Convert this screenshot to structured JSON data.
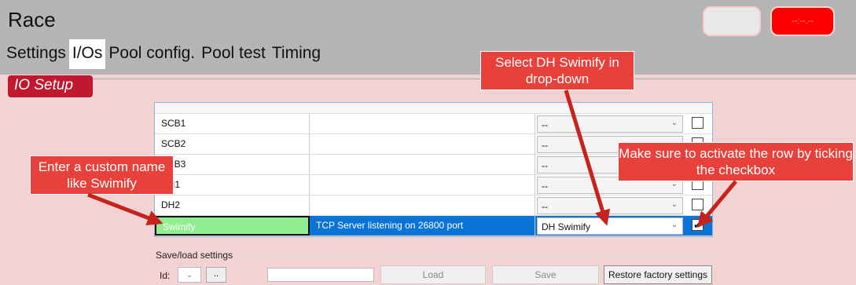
{
  "header": {
    "title": "Race",
    "button_2_label": "--:--.--"
  },
  "tabs": [
    {
      "label": "Settings"
    },
    {
      "label": "I/Os"
    },
    {
      "label": "Pool config."
    },
    {
      "label": "Pool test"
    },
    {
      "label": "Timing"
    }
  ],
  "section": {
    "label": "IO Setup"
  },
  "io_rows": [
    {
      "name": "SCB1",
      "status": "",
      "type": "--",
      "checked": false
    },
    {
      "name": "SCB2",
      "status": "",
      "type": "--",
      "checked": false
    },
    {
      "name": "SCB3",
      "status": "",
      "type": "--",
      "checked": false
    },
    {
      "name": "DH1",
      "status": "",
      "type": "--",
      "checked": false
    },
    {
      "name": "DH2",
      "status": "",
      "type": "--",
      "checked": false
    },
    {
      "name": "Swimify",
      "status": "TCP Server listening on 26800 port",
      "type": "DH Swimify",
      "checked": true
    }
  ],
  "save_settings": {
    "legend": "Save/load settings",
    "id_label": "Id:",
    "more_label": "..",
    "load_label": "Load",
    "save_label": "Save",
    "restore_label": "Restore factory settings"
  },
  "callouts": {
    "name": "Enter a custom name like Swimify",
    "dropdown": "Select DH Swimify in drop-down",
    "checkbox": "Make sure to activate the row by ticking the checkbox"
  },
  "colors": {
    "header_bg": "#b5b5b5",
    "content_bg": "#f2d2d2",
    "section_label": "#c0182e",
    "selected_row": "#0a74d6",
    "name_highlight": "#90ee90",
    "callout": "#e8413c",
    "arrow": "#c8221c"
  }
}
